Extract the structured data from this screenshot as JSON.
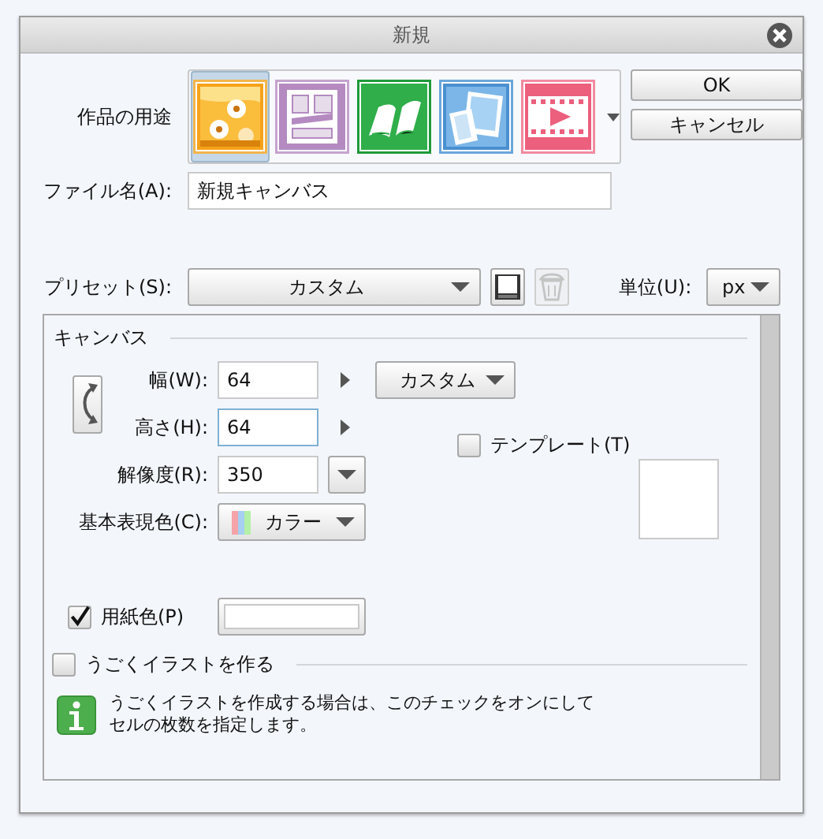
{
  "window": {
    "title": "新規"
  },
  "usage": {
    "label": "作品の用途",
    "items": [
      {
        "kind": "illustration",
        "selected": true
      },
      {
        "kind": "comic",
        "selected": false
      },
      {
        "kind": "book",
        "selected": false
      },
      {
        "kind": "photos",
        "selected": false
      },
      {
        "kind": "animation",
        "selected": false
      }
    ]
  },
  "buttons": [
    {
      "label": "OK"
    },
    {
      "label": "キャンセル"
    }
  ],
  "file_name": {
    "label": "ファイル名(A):",
    "value": "新規キャンバス"
  },
  "preset": {
    "label": "プリセット(S):",
    "value": "カスタム",
    "delete_disabled": true
  },
  "unit": {
    "label": "単位(U):",
    "value": "px"
  },
  "canvas": {
    "title": "キャンバス",
    "width": {
      "label": "幅(W):",
      "value": "64"
    },
    "height": {
      "label": "高さ(H):",
      "value": "64",
      "focused": true
    },
    "size_preset": "カスタム",
    "template": {
      "label": "テンプレート(T)",
      "checked": false
    },
    "resolution": {
      "label": "解像度(R):",
      "value": "350"
    },
    "color_mode": {
      "label": "基本表現色(C):",
      "value": "カラー"
    },
    "paper_color": {
      "label": "用紙色(P)",
      "checked": true
    }
  },
  "animation": {
    "label": "うごくイラストを作る",
    "checked": false,
    "info": [
      "うごくイラストを作成する場合は、このチェックをオンにして",
      "セルの枚数を指定します。"
    ]
  }
}
